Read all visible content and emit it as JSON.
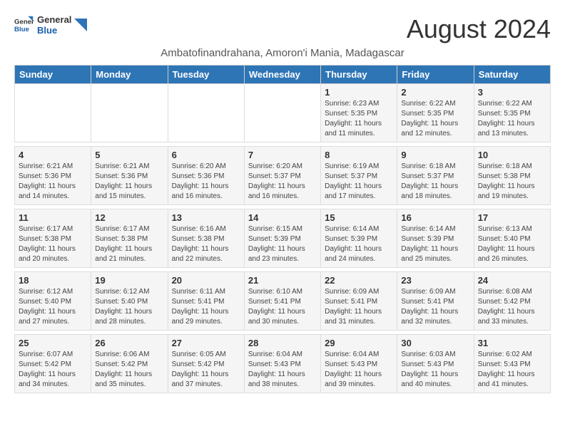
{
  "logo": {
    "general": "General",
    "blue": "Blue"
  },
  "title": {
    "month_year": "August 2024",
    "location": "Ambatofinandrahana, Amoron'i Mania, Madagascar"
  },
  "weekdays": [
    "Sunday",
    "Monday",
    "Tuesday",
    "Wednesday",
    "Thursday",
    "Friday",
    "Saturday"
  ],
  "weeks": [
    [
      {
        "day": "",
        "sunrise": "",
        "sunset": "",
        "daylight": ""
      },
      {
        "day": "",
        "sunrise": "",
        "sunset": "",
        "daylight": ""
      },
      {
        "day": "",
        "sunrise": "",
        "sunset": "",
        "daylight": ""
      },
      {
        "day": "",
        "sunrise": "",
        "sunset": "",
        "daylight": ""
      },
      {
        "day": "1",
        "sunrise": "6:23 AM",
        "sunset": "5:35 PM",
        "daylight": "11 hours and 11 minutes."
      },
      {
        "day": "2",
        "sunrise": "6:22 AM",
        "sunset": "5:35 PM",
        "daylight": "11 hours and 12 minutes."
      },
      {
        "day": "3",
        "sunrise": "6:22 AM",
        "sunset": "5:35 PM",
        "daylight": "11 hours and 13 minutes."
      }
    ],
    [
      {
        "day": "4",
        "sunrise": "6:21 AM",
        "sunset": "5:36 PM",
        "daylight": "11 hours and 14 minutes."
      },
      {
        "day": "5",
        "sunrise": "6:21 AM",
        "sunset": "5:36 PM",
        "daylight": "11 hours and 15 minutes."
      },
      {
        "day": "6",
        "sunrise": "6:20 AM",
        "sunset": "5:36 PM",
        "daylight": "11 hours and 16 minutes."
      },
      {
        "day": "7",
        "sunrise": "6:20 AM",
        "sunset": "5:37 PM",
        "daylight": "11 hours and 16 minutes."
      },
      {
        "day": "8",
        "sunrise": "6:19 AM",
        "sunset": "5:37 PM",
        "daylight": "11 hours and 17 minutes."
      },
      {
        "day": "9",
        "sunrise": "6:18 AM",
        "sunset": "5:37 PM",
        "daylight": "11 hours and 18 minutes."
      },
      {
        "day": "10",
        "sunrise": "6:18 AM",
        "sunset": "5:38 PM",
        "daylight": "11 hours and 19 minutes."
      }
    ],
    [
      {
        "day": "11",
        "sunrise": "6:17 AM",
        "sunset": "5:38 PM",
        "daylight": "11 hours and 20 minutes."
      },
      {
        "day": "12",
        "sunrise": "6:17 AM",
        "sunset": "5:38 PM",
        "daylight": "11 hours and 21 minutes."
      },
      {
        "day": "13",
        "sunrise": "6:16 AM",
        "sunset": "5:38 PM",
        "daylight": "11 hours and 22 minutes."
      },
      {
        "day": "14",
        "sunrise": "6:15 AM",
        "sunset": "5:39 PM",
        "daylight": "11 hours and 23 minutes."
      },
      {
        "day": "15",
        "sunrise": "6:14 AM",
        "sunset": "5:39 PM",
        "daylight": "11 hours and 24 minutes."
      },
      {
        "day": "16",
        "sunrise": "6:14 AM",
        "sunset": "5:39 PM",
        "daylight": "11 hours and 25 minutes."
      },
      {
        "day": "17",
        "sunrise": "6:13 AM",
        "sunset": "5:40 PM",
        "daylight": "11 hours and 26 minutes."
      }
    ],
    [
      {
        "day": "18",
        "sunrise": "6:12 AM",
        "sunset": "5:40 PM",
        "daylight": "11 hours and 27 minutes."
      },
      {
        "day": "19",
        "sunrise": "6:12 AM",
        "sunset": "5:40 PM",
        "daylight": "11 hours and 28 minutes."
      },
      {
        "day": "20",
        "sunrise": "6:11 AM",
        "sunset": "5:41 PM",
        "daylight": "11 hours and 29 minutes."
      },
      {
        "day": "21",
        "sunrise": "6:10 AM",
        "sunset": "5:41 PM",
        "daylight": "11 hours and 30 minutes."
      },
      {
        "day": "22",
        "sunrise": "6:09 AM",
        "sunset": "5:41 PM",
        "daylight": "11 hours and 31 minutes."
      },
      {
        "day": "23",
        "sunrise": "6:09 AM",
        "sunset": "5:41 PM",
        "daylight": "11 hours and 32 minutes."
      },
      {
        "day": "24",
        "sunrise": "6:08 AM",
        "sunset": "5:42 PM",
        "daylight": "11 hours and 33 minutes."
      }
    ],
    [
      {
        "day": "25",
        "sunrise": "6:07 AM",
        "sunset": "5:42 PM",
        "daylight": "11 hours and 34 minutes."
      },
      {
        "day": "26",
        "sunrise": "6:06 AM",
        "sunset": "5:42 PM",
        "daylight": "11 hours and 35 minutes."
      },
      {
        "day": "27",
        "sunrise": "6:05 AM",
        "sunset": "5:42 PM",
        "daylight": "11 hours and 37 minutes."
      },
      {
        "day": "28",
        "sunrise": "6:04 AM",
        "sunset": "5:43 PM",
        "daylight": "11 hours and 38 minutes."
      },
      {
        "day": "29",
        "sunrise": "6:04 AM",
        "sunset": "5:43 PM",
        "daylight": "11 hours and 39 minutes."
      },
      {
        "day": "30",
        "sunrise": "6:03 AM",
        "sunset": "5:43 PM",
        "daylight": "11 hours and 40 minutes."
      },
      {
        "day": "31",
        "sunrise": "6:02 AM",
        "sunset": "5:43 PM",
        "daylight": "11 hours and 41 minutes."
      }
    ]
  ],
  "labels": {
    "sunrise_prefix": "Sunrise: ",
    "sunset_prefix": "Sunset: ",
    "daylight_prefix": "Daylight: "
  }
}
